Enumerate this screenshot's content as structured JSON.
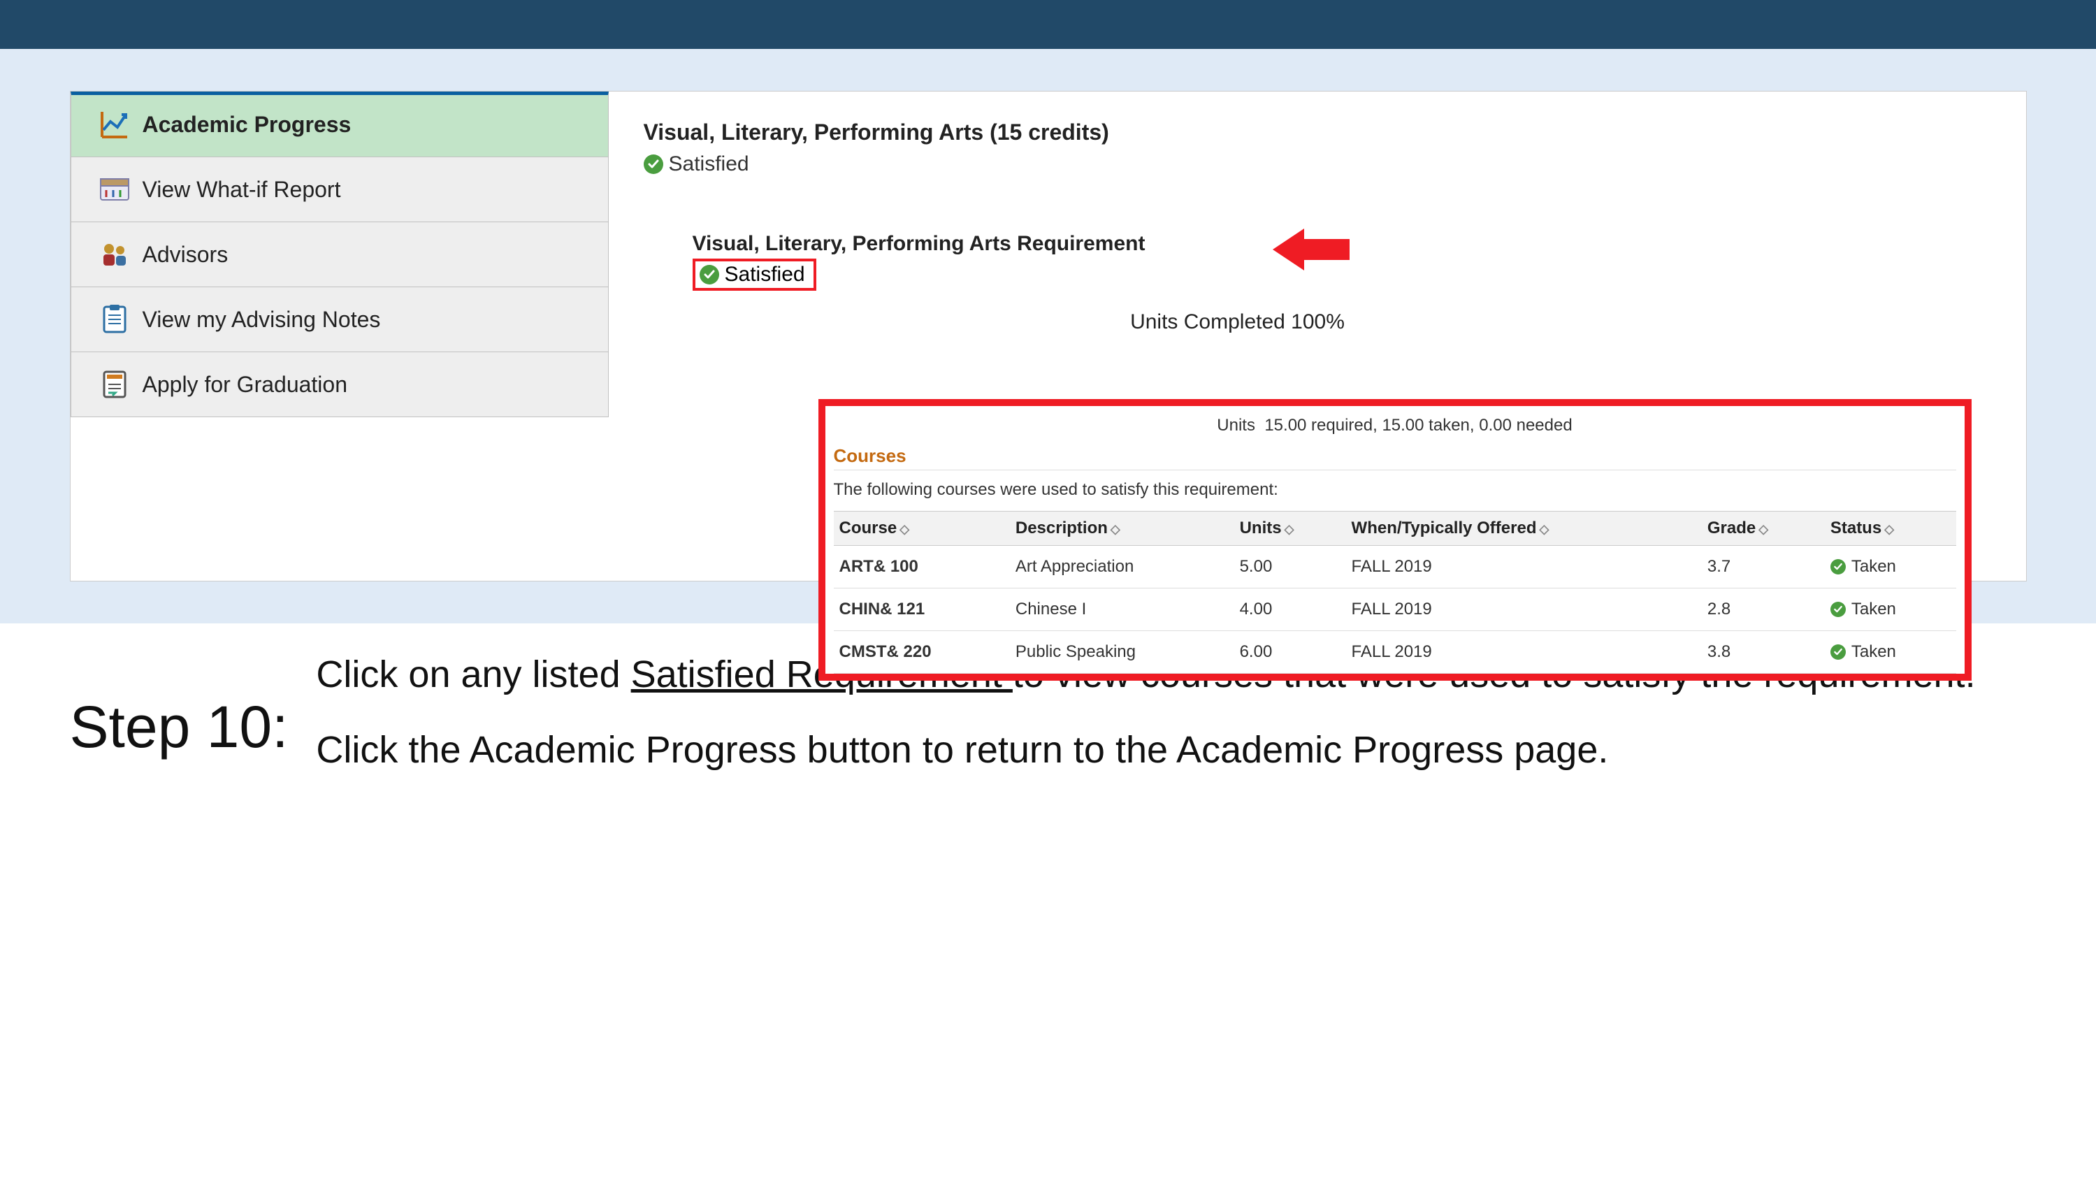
{
  "sidebar": {
    "items": [
      {
        "label": "Academic Progress"
      },
      {
        "label": "View What-if Report"
      },
      {
        "label": "Advisors"
      },
      {
        "label": "View my Advising Notes"
      },
      {
        "label": "Apply for Graduation"
      }
    ]
  },
  "requirement": {
    "title": "Visual, Literary, Performing Arts (15 credits)",
    "status": "Satisfied",
    "sub_title": "Visual, Literary, Performing Arts Requirement",
    "sub_status": "Satisfied",
    "units_completed_text": "Units Completed 100%"
  },
  "courses_panel": {
    "units_label": "Units",
    "units_summary": "15.00 required, 15.00 taken, 0.00 needed",
    "heading": "Courses",
    "note": "The following courses were used to satisfy this requirement:",
    "columns": {
      "course": "Course",
      "description": "Description",
      "units": "Units",
      "when": "When/Typically Offered",
      "grade": "Grade",
      "status": "Status"
    },
    "rows": [
      {
        "course": "ART& 100",
        "description": "Art Appreciation",
        "units": "5.00",
        "when": "FALL 2019",
        "grade": "3.7",
        "status": "Taken"
      },
      {
        "course": "CHIN& 121",
        "description": "Chinese I",
        "units": "4.00",
        "when": "FALL 2019",
        "grade": "2.8",
        "status": "Taken"
      },
      {
        "course": "CMST& 220",
        "description": "Public Speaking",
        "units": "6.00",
        "when": "FALL 2019",
        "grade": "3.8",
        "status": "Taken"
      }
    ]
  },
  "instructions": {
    "step_label": "Step 10:",
    "line1_pre": "Click on any listed ",
    "line1_link": "Satisfied Requirement ",
    "line1_post": "to view courses that were used to satisfy the requirement.",
    "line2": "Click the Academic Progress button to return to the Academic Progress page."
  }
}
